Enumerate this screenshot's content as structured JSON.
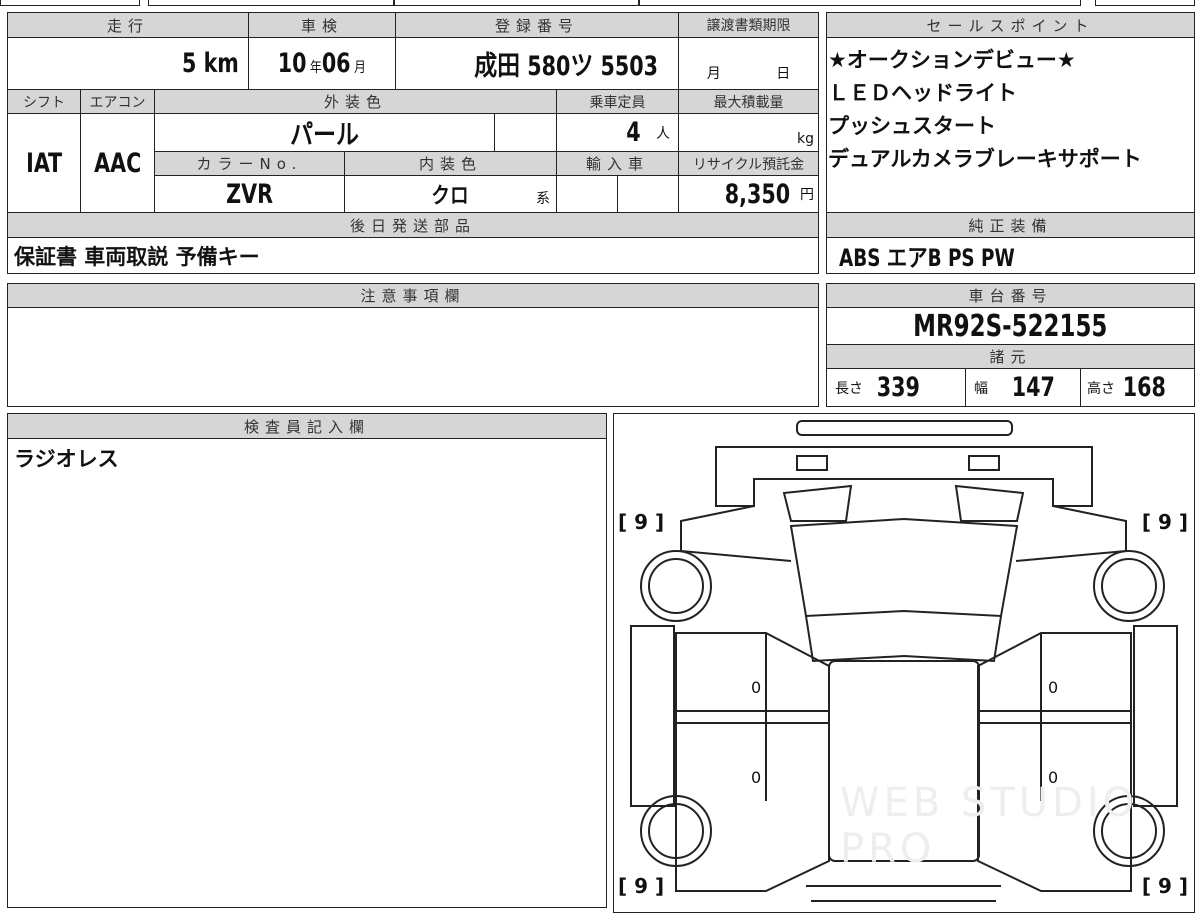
{
  "headers": {
    "mileage": "走行",
    "inspection": "車検",
    "registration": "登録番号",
    "transfer_deadline": "譲渡書類期限",
    "shift": "シフト",
    "aircon": "エアコン",
    "exterior_color": "外装色",
    "capacity": "乗車定員",
    "max_load": "最大積載量",
    "color_no": "カラーNo.",
    "interior_color": "内装色",
    "import": "輸入車",
    "recycle": "リサイクル預託金",
    "later_parts": "後日発送部品",
    "sales_points": "セールスポイント",
    "genuine_equipment": "純正装備",
    "notes": "注意事項欄",
    "chassis_no": "車台番号",
    "specs": "諸元",
    "inspector": "検査員記入欄"
  },
  "values": {
    "mileage": "5",
    "mileage_unit": "km",
    "inspection_year": "10",
    "year_unit": "年",
    "inspection_month": "06",
    "month_unit": "月",
    "registration": "成田 580ツ 5503",
    "transfer_month": "月",
    "transfer_day": "日",
    "shift": "IAT",
    "aircon": "AAC",
    "exterior_color": "パール",
    "capacity": "4",
    "capacity_unit": "人",
    "max_load_unit": "kg",
    "color_no": "ZVR",
    "interior_color": "クロ",
    "interior_suffix": "系",
    "recycle": "8,350",
    "recycle_unit": "円",
    "later_parts": "保証書 車両取説 予備キー",
    "genuine_equipment": "ABS エアB PS PW",
    "chassis_no": "MR92S-522155",
    "length_label": "長さ",
    "length": "339",
    "width_label": "幅",
    "width": "147",
    "height_label": "高さ",
    "height": "168",
    "inspector_note": "ラジオレス"
  },
  "sales_points": [
    "★オークションデビュー★",
    "ＬＥＤヘッドライト",
    "プッシュスタート",
    "デュアルカメラブレーキサポート"
  ],
  "diagram": {
    "tire_labels": [
      "[ 9 ]",
      "[ 9 ]",
      "[ 9 ]",
      "[ 9 ]"
    ],
    "panel_marks": [
      "0",
      "0",
      "0",
      "0"
    ]
  },
  "watermark": "WEB STUDIO PRO"
}
